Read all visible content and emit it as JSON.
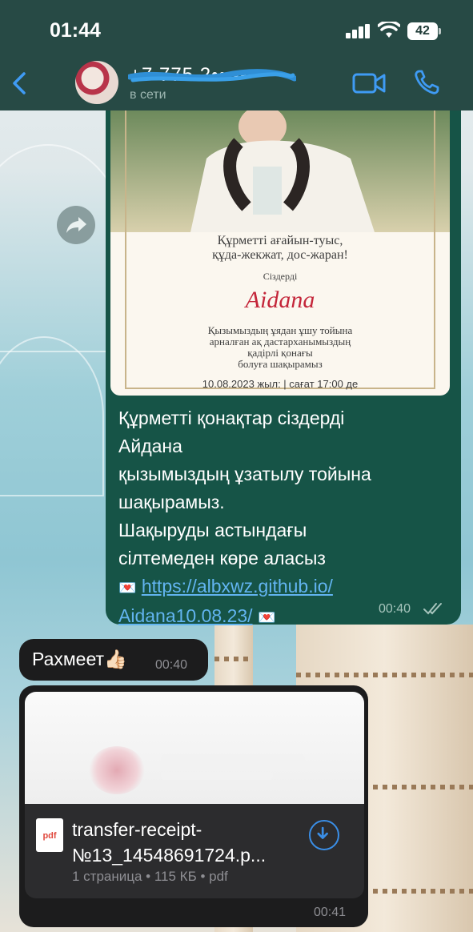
{
  "status_bar": {
    "time": "01:44",
    "battery": "42"
  },
  "header": {
    "contact_name": "+7 775 2•• ••••",
    "contact_status": "в сети"
  },
  "messages": {
    "outgoing": {
      "invite_card": {
        "greeting_line1": "Құрметті ағайын-туыс,",
        "greeting_line2": "құда-жекжат, дос-жаран!",
        "sizderdi": "Сіздерді",
        "name": "Aidana",
        "text_line1": "Қызымыздың ұядан ұшу тойына",
        "text_line2": "арналған  ақ дастарханымыздың",
        "text_line3": "қадірлі қонағы",
        "text_line4": "болуға шақырамыз",
        "date_line": "10.08.2023 жыл:   |   сағат 17:00 де"
      },
      "text_line1": "Құрметті қонақтар сіздерді",
      "text_line2": "Айдана",
      "text_line3": "қызымыздың ұзатылу тойына",
      "text_line4": "шақырамыз.",
      "text_line5": "Шақыруды астындағы",
      "text_line6": "сілтемеден көре аласыз",
      "link_part1": "https://albxwz.github.io/",
      "link_part2": "Aidana10.08.23/",
      "heart": "💌",
      "time": "00:40"
    },
    "incoming_text": {
      "text": "Рахмеет👍🏻",
      "time": "00:40"
    },
    "incoming_file": {
      "icon_label": "pdf",
      "file_name_line1": "transfer-receipt-",
      "file_name_line2": "№13_14548691724.p...",
      "meta": "1 страница • 115 КБ • pdf",
      "time": "00:41"
    }
  },
  "icons": [
    "back-icon",
    "video-call-icon",
    "phone-icon",
    "forward-icon",
    "read-check-icon",
    "download-icon",
    "pdf-file-icon"
  ]
}
